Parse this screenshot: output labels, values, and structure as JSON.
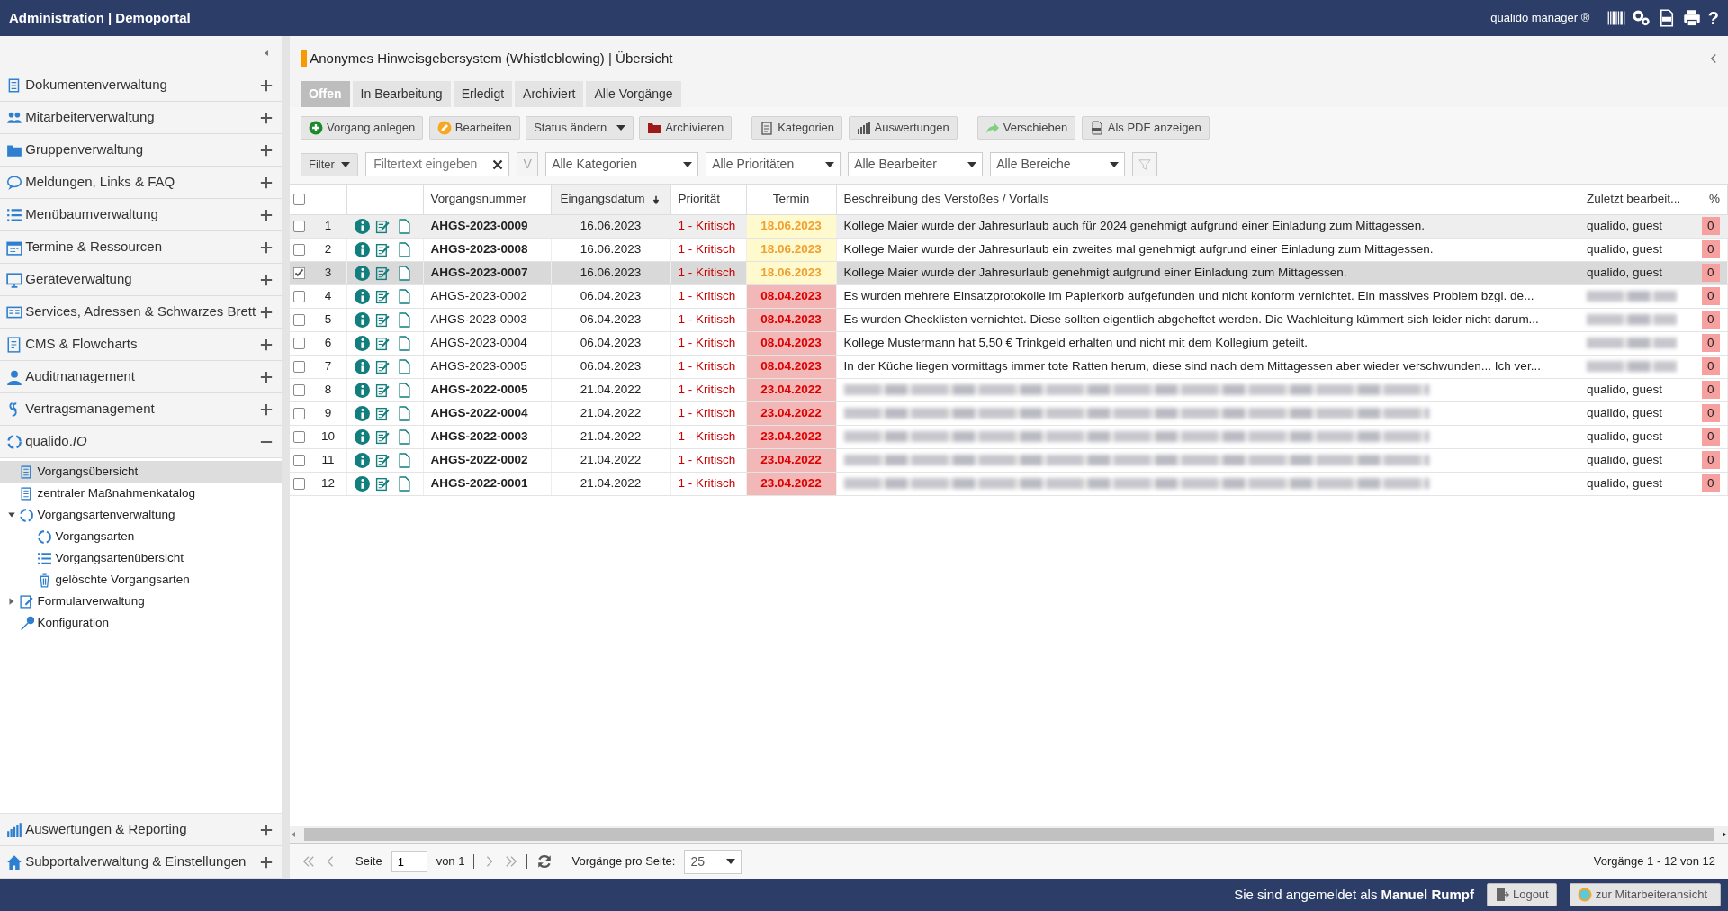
{
  "header": {
    "title": "Administration | Demoportal",
    "product": "qualido manager ®",
    "help": "?"
  },
  "sidebar": {
    "items": [
      {
        "label": "Dokumentenverwaltung",
        "expanded": false
      },
      {
        "label": "Mitarbeiterverwaltung",
        "expanded": false
      },
      {
        "label": "Gruppenverwaltung",
        "expanded": false
      },
      {
        "label": "Meldungen, Links & FAQ",
        "expanded": false
      },
      {
        "label": "Menübaumverwaltung",
        "expanded": false
      },
      {
        "label": "Termine & Ressourcen",
        "expanded": false
      },
      {
        "label": "Geräteverwaltung",
        "expanded": false
      },
      {
        "label": "Services, Adressen & Schwarzes Brett",
        "expanded": false
      },
      {
        "label": "CMS & Flowcharts",
        "expanded": false
      },
      {
        "label": "Auditmanagement",
        "expanded": false
      },
      {
        "label": "Vertragsmanagement",
        "expanded": false
      },
      {
        "label": "qualido.*IO*",
        "expanded": true
      }
    ],
    "tree": [
      {
        "label": "Vorgangsübersicht",
        "selected": true
      },
      {
        "label": "zentraler Maßnahmenkatalog",
        "selected": false
      },
      {
        "label": "Vorgangsartenverwaltung",
        "selected": false,
        "expanded": true,
        "children": [
          {
            "label": "Vorgangsarten",
            "selected": false
          },
          {
            "label": "Vorgangsartenübersicht",
            "selected": false
          },
          {
            "label": "gelöschte Vorgangsarten",
            "selected": false
          }
        ]
      },
      {
        "label": "Formularverwaltung",
        "selected": false,
        "expanded": false
      },
      {
        "label": "Konfiguration",
        "selected": false
      }
    ],
    "bottom_items": [
      {
        "label": "Auswertungen & Reporting",
        "expanded": false
      },
      {
        "label": "Subportalverwaltung & Einstellungen",
        "expanded": false
      }
    ]
  },
  "page_title": "Anonymes Hinweisgebersystem (Whistleblowing) | Übersicht",
  "tabs": [
    {
      "label": "Offen",
      "selected": true
    },
    {
      "label": "In Bearbeitung",
      "selected": false
    },
    {
      "label": "Erledigt",
      "selected": false
    },
    {
      "label": "Archiviert",
      "selected": false
    },
    {
      "label": "Alle Vorgänge",
      "selected": false
    }
  ],
  "toolbar": [
    {
      "label": "Vorgang anlegen",
      "dropdown": false,
      "separator_after": false
    },
    {
      "label": "Bearbeiten",
      "dropdown": false,
      "separator_after": false
    },
    {
      "label": "Status ändern",
      "dropdown": true,
      "separator_after": false
    },
    {
      "label": "Archivieren",
      "dropdown": false,
      "separator_after": true
    },
    {
      "label": "Kategorien",
      "dropdown": false,
      "separator_after": false
    },
    {
      "label": "Auswertungen",
      "dropdown": false,
      "separator_after": true
    },
    {
      "label": "Verschieben",
      "dropdown": false,
      "separator_after": false
    },
    {
      "label": "Als PDF anzeigen",
      "dropdown": false,
      "separator_after": false
    }
  ],
  "filter": {
    "button": "Filter",
    "placeholder": "Filtertext eingeben",
    "v_button": "V",
    "selects": [
      "Alle Kategorien",
      "Alle Prioritäten",
      "Alle Bearbeiter",
      "Alle Bereiche"
    ]
  },
  "table": {
    "select_all_checked": false,
    "columns": [
      {
        "label": "Vorgangsnummer",
        "sorted": false
      },
      {
        "label": "Eingangsdatum",
        "sorted": true
      },
      {
        "label": "Priorität",
        "sorted": false
      },
      {
        "label": "Termin",
        "sorted": false
      },
      {
        "label": "Beschreibung des Verstoßes / Vorfalls",
        "sorted": false
      },
      {
        "label": "Zuletzt bearbeit...",
        "sorted": false
      },
      {
        "label": "%",
        "sorted": false
      }
    ],
    "rows": [
      {
        "index": "1",
        "checked": false,
        "selected": false,
        "highlighted": true,
        "unread": true,
        "number": "AHGS-2023-0009",
        "date": "16.06.2023",
        "priority": "1 - Kritisch",
        "due": "18.06.2023",
        "overdue": false,
        "description": "Kollege Maier wurde der Jahresurlaub auch für 2024 genehmigt aufgrund einer Einladung zum Mittagessen.",
        "editor": "qualido, guest",
        "percent": "0"
      },
      {
        "index": "2",
        "checked": false,
        "selected": false,
        "highlighted": false,
        "unread": true,
        "number": "AHGS-2023-0008",
        "date": "16.06.2023",
        "priority": "1 - Kritisch",
        "due": "18.06.2023",
        "overdue": false,
        "description": "Kollege Maier wurde der Jahresurlaub ein zweites mal genehmigt aufgrund einer Einladung zum Mittagessen.",
        "editor": "qualido, guest",
        "percent": "0"
      },
      {
        "index": "3",
        "checked": true,
        "selected": true,
        "highlighted": false,
        "unread": true,
        "number": "AHGS-2023-0007",
        "date": "16.06.2023",
        "priority": "1 - Kritisch",
        "due": "18.06.2023",
        "overdue": false,
        "description": "Kollege Maier wurde der Jahresurlaub genehmigt aufgrund einer Einladung zum Mittagessen.",
        "editor": "qualido, guest",
        "percent": "0"
      },
      {
        "index": "4",
        "checked": false,
        "selected": false,
        "highlighted": false,
        "unread": false,
        "number": "AHGS-2023-0002",
        "date": "06.04.2023",
        "priority": "1 - Kritisch",
        "due": "08.04.2023",
        "overdue": true,
        "description": "Es wurden mehrere Einsatzprotokolle im Papierkorb aufgefunden und nicht konform vernichtet. Ein massives Problem bzgl. de...",
        "editor_redacted": true,
        "percent": "0"
      },
      {
        "index": "5",
        "checked": false,
        "selected": false,
        "highlighted": false,
        "unread": false,
        "number": "AHGS-2023-0003",
        "date": "06.04.2023",
        "priority": "1 - Kritisch",
        "due": "08.04.2023",
        "overdue": true,
        "description": "Es wurden Checklisten vernichtet. Diese sollten eigentlich abgeheftet werden. Die Wachleitung kümmert sich leider nicht darum...",
        "editor_redacted": true,
        "percent": "0"
      },
      {
        "index": "6",
        "checked": false,
        "selected": false,
        "highlighted": false,
        "unread": false,
        "number": "AHGS-2023-0004",
        "date": "06.04.2023",
        "priority": "1 - Kritisch",
        "due": "08.04.2023",
        "overdue": true,
        "description": "Kollege Mustermann hat 5,50 € Trinkgeld erhalten und nicht mit dem Kollegium geteilt.",
        "editor_redacted": true,
        "percent": "0"
      },
      {
        "index": "7",
        "checked": false,
        "selected": false,
        "highlighted": false,
        "unread": false,
        "number": "AHGS-2023-0005",
        "date": "06.04.2023",
        "priority": "1 - Kritisch",
        "due": "08.04.2023",
        "overdue": true,
        "description": "In der Küche liegen vormittags immer tote Ratten herum, diese sind nach dem Mittagessen aber wieder verschwunden... Ich ver...",
        "editor_redacted": true,
        "percent": "0"
      },
      {
        "index": "8",
        "checked": false,
        "selected": false,
        "highlighted": false,
        "unread": true,
        "number": "AHGS-2022-0005",
        "date": "21.04.2022",
        "priority": "1 - Kritisch",
        "due": "23.04.2022",
        "overdue": true,
        "description_redacted": true,
        "editor": "qualido, guest",
        "percent": "0"
      },
      {
        "index": "9",
        "checked": false,
        "selected": false,
        "highlighted": false,
        "unread": true,
        "number": "AHGS-2022-0004",
        "date": "21.04.2022",
        "priority": "1 - Kritisch",
        "due": "23.04.2022",
        "overdue": true,
        "description_redacted": true,
        "editor": "qualido, guest",
        "percent": "0"
      },
      {
        "index": "10",
        "checked": false,
        "selected": false,
        "highlighted": false,
        "unread": true,
        "number": "AHGS-2022-0003",
        "date": "21.04.2022",
        "priority": "1 - Kritisch",
        "due": "23.04.2022",
        "overdue": true,
        "description_redacted": true,
        "editor": "qualido, guest",
        "percent": "0"
      },
      {
        "index": "11",
        "checked": false,
        "selected": false,
        "highlighted": false,
        "unread": true,
        "number": "AHGS-2022-0002",
        "date": "21.04.2022",
        "priority": "1 - Kritisch",
        "due": "23.04.2022",
        "overdue": true,
        "description_redacted": true,
        "editor": "qualido, guest",
        "percent": "0"
      },
      {
        "index": "12",
        "checked": false,
        "selected": false,
        "highlighted": false,
        "unread": true,
        "number": "AHGS-2022-0001",
        "date": "21.04.2022",
        "priority": "1 - Kritisch",
        "due": "23.04.2022",
        "overdue": true,
        "description_redacted": true,
        "editor": "qualido, guest",
        "percent": "0"
      }
    ]
  },
  "pager": {
    "page_label": "Seite",
    "page": "1",
    "of": "von 1",
    "per_page_label": "Vorgänge pro Seite:",
    "per_page": "25",
    "summary": "Vorgänge 1 - 12 von 12"
  },
  "footer": {
    "login_text": "Sie sind angemeldet als **Manuel Rumpf**",
    "logout": "Logout",
    "switch_view": "zur Mitarbeiteransicht"
  }
}
